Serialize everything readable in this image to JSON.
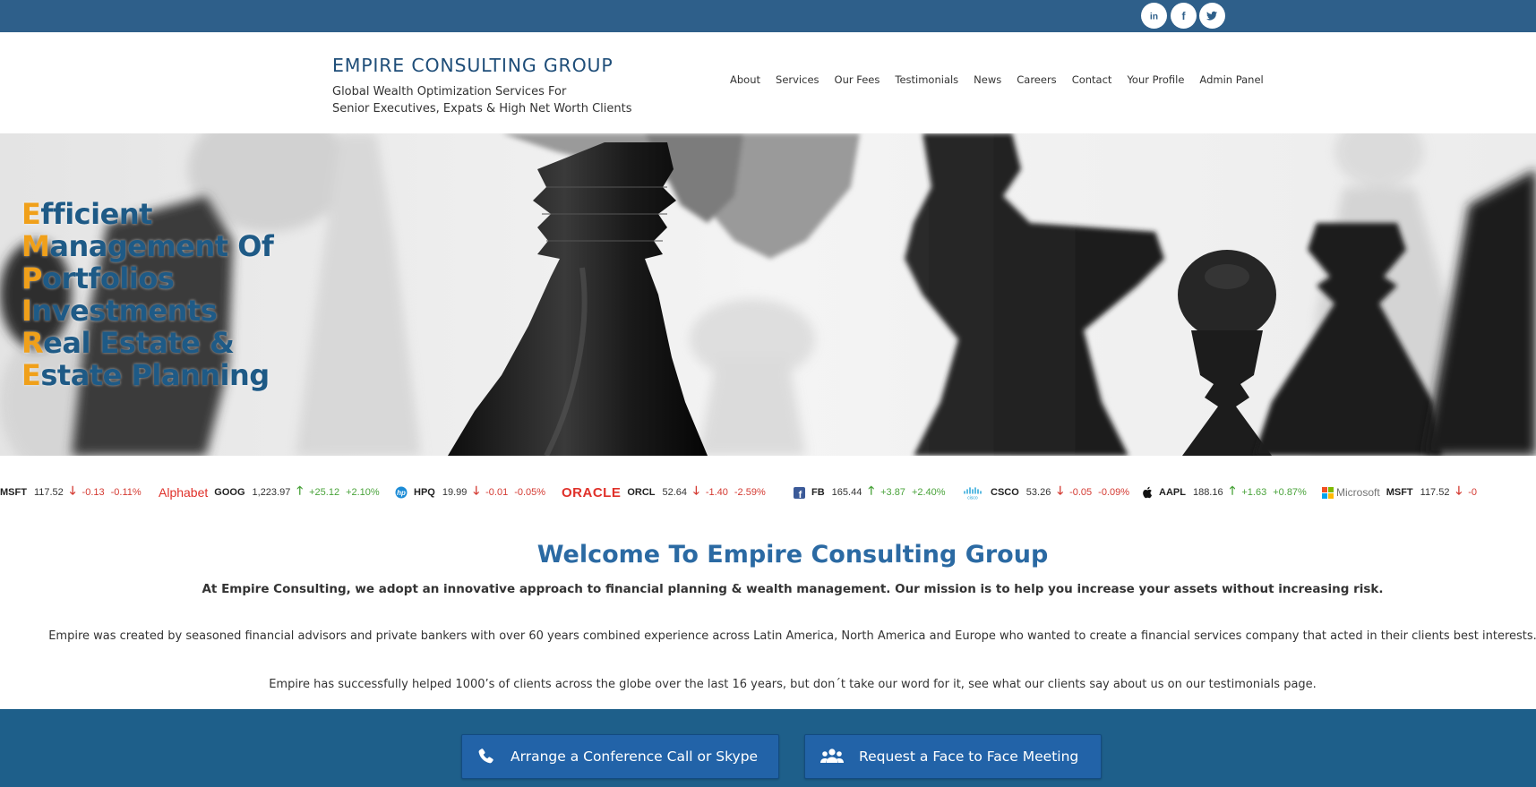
{
  "social": [
    {
      "name": "linkedin",
      "glyph": "in"
    },
    {
      "name": "facebook",
      "glyph": "f"
    },
    {
      "name": "twitter",
      "glyph": "t"
    }
  ],
  "brand": {
    "title": "EMPIRE CONSULTING GROUP",
    "tagline_line1": "Global Wealth Optimization Services For",
    "tagline_line2": "Senior Executives, Expats & High Net Worth Clients"
  },
  "nav": [
    "About",
    "Services",
    "Our Fees",
    "Testimonials",
    "News",
    "Careers",
    "Contact",
    "Your Profile",
    "Admin Panel"
  ],
  "hero": {
    "lines": [
      {
        "cap": "E",
        "rest": "fficient"
      },
      {
        "cap": "M",
        "rest": "anagement Of"
      },
      {
        "cap": "P",
        "rest": "ortfolios"
      },
      {
        "cap": "I",
        "rest": "nvestments"
      },
      {
        "cap": "R",
        "rest": "eal Estate &"
      },
      {
        "cap": "E",
        "rest": "state Planning"
      }
    ],
    "accent_color": "#f0a01a",
    "text_color": "#1e5a86"
  },
  "ticker": [
    {
      "logo": "",
      "symbol": "MSFT",
      "price": "117.52",
      "dir": "down",
      "change": "-0.13",
      "pct": "-0.11%"
    },
    {
      "logo": "Alphabet",
      "symbol": "GOOG",
      "price": "1,223.97",
      "dir": "up",
      "change": "+25.12",
      "pct": "+2.10%"
    },
    {
      "logo": "hp",
      "symbol": "HPQ",
      "price": "19.99",
      "dir": "down",
      "change": "-0.01",
      "pct": "-0.05%"
    },
    {
      "logo": "ORACLE",
      "symbol": "ORCL",
      "price": "52.64",
      "dir": "down",
      "change": "-1.40",
      "pct": "-2.59%"
    },
    {
      "logo": "facebook",
      "symbol": "FB",
      "price": "165.44",
      "dir": "up",
      "change": "+3.87",
      "pct": "+2.40%"
    },
    {
      "logo": "cisco",
      "symbol": "CSCO",
      "price": "53.26",
      "dir": "down",
      "change": "-0.05",
      "pct": "-0.09%"
    },
    {
      "logo": "apple",
      "symbol": "AAPL",
      "price": "188.16",
      "dir": "up",
      "change": "+1.63",
      "pct": "+0.87%"
    },
    {
      "logo": "Microsoft",
      "symbol": "MSFT",
      "price": "117.52",
      "dir": "down",
      "change": "-0",
      "pct": ""
    }
  ],
  "arrows": {
    "up": "🡑",
    "down": "🡓"
  },
  "welcome": {
    "title": "Welcome To Empire Consulting Group",
    "lead": "At Empire Consulting, we adopt an innovative approach to financial planning & wealth management. Our mission is to help you increase your assets without increasing risk.",
    "para1": "Empire was created by seasoned financial advisors and private bankers with over 60 years combined experience across Latin America, North America and Europe who wanted to create a financial services company that acted in their clients best interests.",
    "para2": "Empire has successfully helped 1000’s of clients across the globe over the last 16 years, but don´t take our word for it, see what our clients say about us on our testimonials page."
  },
  "cta": {
    "call_label": "Arrange a Conference Call or Skype",
    "meet_label": "Request a Face to Face Meeting"
  },
  "colors": {
    "topbar": "#2e5f8a",
    "band": "#1e5f8a",
    "button": "#2263a8",
    "down": "#d43a32",
    "up": "#4aa33b"
  }
}
